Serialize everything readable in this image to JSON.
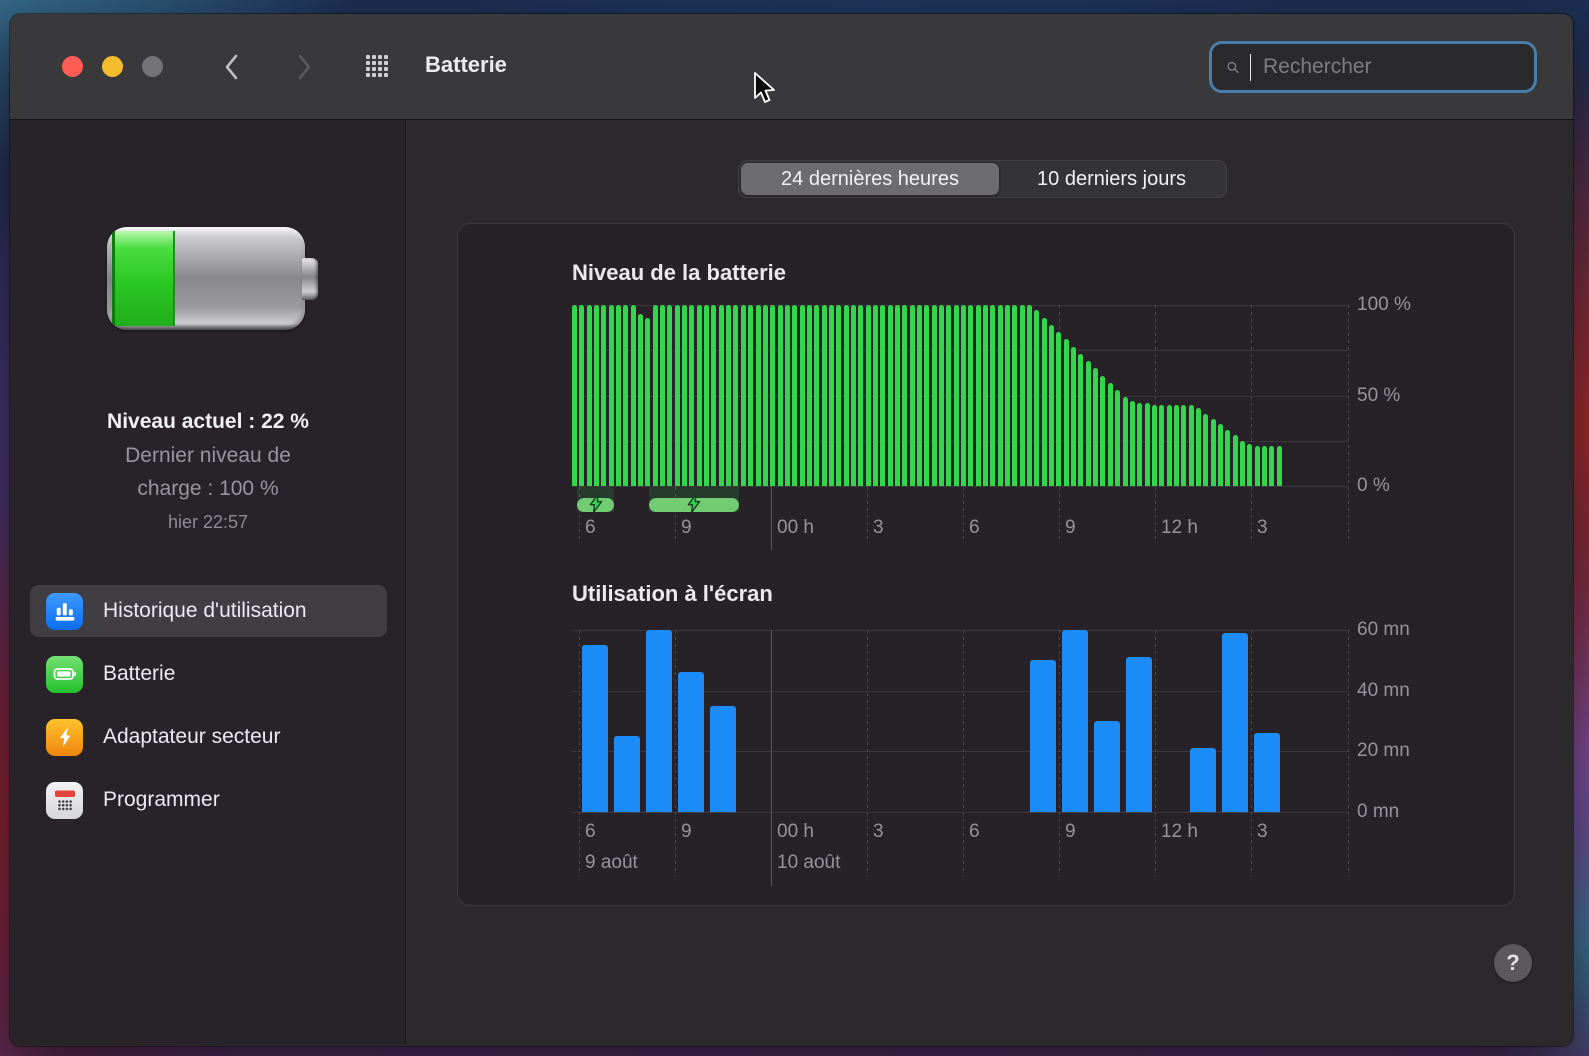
{
  "window": {
    "title": "Batterie"
  },
  "titlebar": {
    "search_placeholder": "Rechercher"
  },
  "sidebar": {
    "battery_summary": {
      "current_level": "Niveau actuel : 22 %",
      "last_charge_line1": "Dernier niveau de",
      "last_charge_line2": "charge : 100 %",
      "last_charge_time": "hier 22:57"
    },
    "items": [
      {
        "label": "Historique d'utilisation",
        "selected": true,
        "icon": "usage-history-icon"
      },
      {
        "label": "Batterie",
        "selected": false,
        "icon": "battery-icon"
      },
      {
        "label": "Adaptateur secteur",
        "selected": false,
        "icon": "power-adapter-icon"
      },
      {
        "label": "Programmer",
        "selected": false,
        "icon": "schedule-icon"
      }
    ]
  },
  "tabs": [
    {
      "label": "24 dernières heures",
      "selected": true
    },
    {
      "label": "10 derniers jours",
      "selected": false
    }
  ],
  "help_label": "?",
  "chart_data": [
    {
      "type": "bar",
      "title": "Niveau de la batterie",
      "ylabel_ticks": [
        "100 %",
        "50 %",
        "0 %"
      ],
      "ylim": [
        0,
        100
      ],
      "bar_interval_minutes": 15,
      "bar_color": "#32d74b",
      "x_ticks": [
        {
          "label": "6",
          "hour": 0
        },
        {
          "label": "9",
          "hour": 3
        },
        {
          "label": "00 h",
          "hour": 6,
          "solid": true
        },
        {
          "label": "3",
          "hour": 9
        },
        {
          "label": "6",
          "hour": 12
        },
        {
          "label": "9",
          "hour": 15
        },
        {
          "label": "12 h",
          "hour": 18
        },
        {
          "label": "3",
          "hour": 21
        }
      ],
      "charging_periods": [
        {
          "start_hour": -0.05,
          "end_hour": 1.1
        },
        {
          "start_hour": 2.2,
          "end_hour": 5.0
        }
      ],
      "values": [
        100,
        100,
        100,
        100,
        100,
        100,
        100,
        100,
        100,
        95,
        93,
        100,
        100,
        100,
        100,
        100,
        100,
        100,
        100,
        100,
        100,
        100,
        100,
        100,
        100,
        100,
        100,
        100,
        100,
        100,
        100,
        100,
        100,
        100,
        100,
        100,
        100,
        100,
        100,
        100,
        100,
        100,
        100,
        100,
        100,
        100,
        100,
        100,
        100,
        100,
        100,
        100,
        100,
        100,
        100,
        100,
        100,
        100,
        100,
        100,
        100,
        100,
        100,
        97,
        93,
        89,
        85,
        81,
        77,
        73,
        69,
        65,
        61,
        57,
        53,
        49,
        47,
        46,
        46,
        45,
        45,
        45,
        45,
        45,
        45,
        43,
        40,
        37,
        34,
        31,
        28,
        25,
        23,
        22,
        22,
        22,
        22
      ]
    },
    {
      "type": "bar",
      "title": "Utilisation à l'écran",
      "ylabel_ticks": [
        "60 mn",
        "40 mn",
        "20 mn",
        "0 mn"
      ],
      "ylim": [
        0,
        60
      ],
      "bar_color": "#1b8cf8",
      "x_ticks": [
        {
          "label": "6",
          "hour": 0
        },
        {
          "label": "9",
          "hour": 3
        },
        {
          "label": "00 h",
          "hour": 6,
          "solid": true
        },
        {
          "label": "3",
          "hour": 9
        },
        {
          "label": "6",
          "hour": 12
        },
        {
          "label": "9",
          "hour": 15
        },
        {
          "label": "12 h",
          "hour": 18
        },
        {
          "label": "3",
          "hour": 21
        }
      ],
      "date_labels": [
        {
          "label": "9 août",
          "hour": 0
        },
        {
          "label": "10 août",
          "hour": 6
        }
      ],
      "bars": [
        {
          "hour": 0,
          "minutes": 55
        },
        {
          "hour": 1,
          "minutes": 25
        },
        {
          "hour": 2,
          "minutes": 60
        },
        {
          "hour": 3,
          "minutes": 46
        },
        {
          "hour": 4,
          "minutes": 35
        },
        {
          "hour": 14,
          "minutes": 50
        },
        {
          "hour": 15,
          "minutes": 60
        },
        {
          "hour": 16,
          "minutes": 30
        },
        {
          "hour": 17,
          "minutes": 51
        },
        {
          "hour": 19,
          "minutes": 21
        },
        {
          "hour": 20,
          "minutes": 59
        },
        {
          "hour": 21,
          "minutes": 26
        }
      ]
    }
  ]
}
